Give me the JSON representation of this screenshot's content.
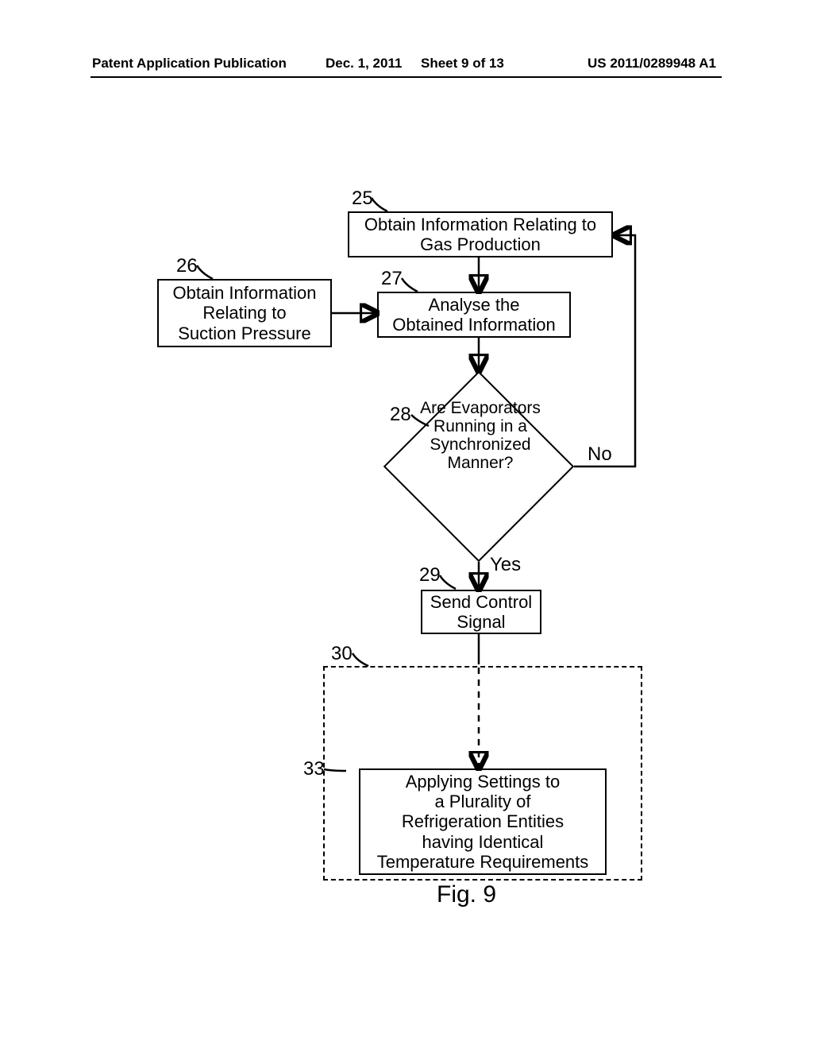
{
  "header": {
    "left": "Patent Application Publication",
    "date": "Dec. 1, 2011",
    "sheet": "Sheet 9 of 13",
    "pub": "US 2011/0289948 A1"
  },
  "nodes": {
    "n25": {
      "ref": "25",
      "text": "Obtain Information Relating to\nGas Production"
    },
    "n26": {
      "ref": "26",
      "text": "Obtain Information\nRelating to\nSuction Pressure"
    },
    "n27": {
      "ref": "27",
      "text": "Analyse the\nObtained Information"
    },
    "n28": {
      "ref": "28",
      "text": "Are\nEvaporators\nRunning\nin a\nSynchronized\nManner?"
    },
    "n29": {
      "ref": "29",
      "text": "Send Control\nSignal"
    },
    "n30": {
      "ref": "30"
    },
    "n33": {
      "ref": "33",
      "text": "Applying Settings to\na Plurality of\nRefrigeration Entities\nhaving Identical\nTemperature Requirements"
    }
  },
  "edges": {
    "no": "No",
    "yes": "Yes"
  },
  "figure": "Fig.  9"
}
